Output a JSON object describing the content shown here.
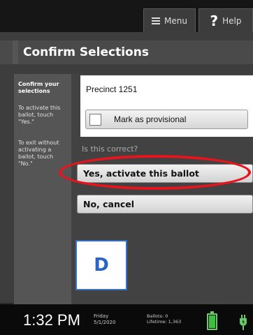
{
  "header": {
    "menu_label": "Menu",
    "help_label": "Help",
    "help_glyph": "?"
  },
  "page_title": "Confirm Selections",
  "sidebar": {
    "heading": "Confirm your selections",
    "activate_text": "To activate this ballot, touch \"Yes.\"",
    "exit_text": "To exit without activating a ballot, touch \"No.\""
  },
  "main": {
    "precinct": "Precinct 1251",
    "provisional_label": "Mark as provisional",
    "provisional_checked": false,
    "question": "Is this correct?",
    "yes_button": "Yes, activate this ballot",
    "no_button": "No, cancel"
  },
  "overlay": {
    "label": "D",
    "label_color": "#2a64c6",
    "highlight_color": "#e8141d"
  },
  "status_bar": {
    "time": "1:32 PM",
    "day": "Friday",
    "date": "5/1/2020",
    "ballots_label": "Ballots:",
    "ballots_value": "0",
    "lifetime_label": "Lifetime:",
    "lifetime_value": "1,363",
    "battery_icon": "battery-full-icon",
    "power_icon": "power-plug-icon"
  }
}
